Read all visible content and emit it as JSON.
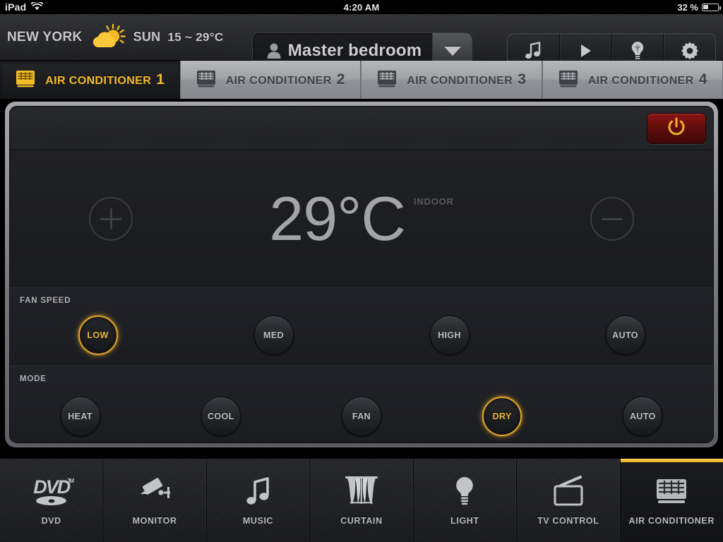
{
  "statusbar": {
    "device": "iPad",
    "wifi_icon": "wifi-icon",
    "time": "4:20 AM",
    "battery_percent": "32 %",
    "battery_icon": "battery-icon"
  },
  "header": {
    "city": "NEW YORK",
    "weather_icon": "sun-behind-cloud-icon",
    "day": "SUN",
    "temp_range": "15 ~ 29°C",
    "room": {
      "person_icon": "person-icon",
      "name": "Master bedroom",
      "caret_icon": "chevron-down-icon"
    },
    "icon_buttons": [
      {
        "name": "music-icon",
        "label": "Music"
      },
      {
        "name": "play-icon",
        "label": "Play"
      },
      {
        "name": "lightbulb-icon",
        "label": "Light"
      },
      {
        "name": "gear-icon",
        "label": "Settings"
      }
    ]
  },
  "tabs": [
    {
      "label": "AIR CONDITIONER",
      "number": "1",
      "icon": "air-conditioner-icon",
      "active": true
    },
    {
      "label": "AIR CONDITIONER",
      "number": "2",
      "icon": "air-conditioner-icon",
      "active": false
    },
    {
      "label": "AIR CONDITIONER",
      "number": "3",
      "icon": "air-conditioner-icon",
      "active": false
    },
    {
      "label": "AIR CONDITIONER",
      "number": "4",
      "icon": "air-conditioner-icon",
      "active": false
    }
  ],
  "panel": {
    "power_button": {
      "icon": "power-icon",
      "color": "#6b0f0d",
      "glyph_color": "#f0b429"
    },
    "temperature": {
      "value": "29°C",
      "label": "INDOOR",
      "increase_icon": "plus-circle-icon",
      "decrease_icon": "minus-circle-icon"
    },
    "fan_speed": {
      "title": "FAN SPEED",
      "options": [
        {
          "label": "LOW",
          "selected": true
        },
        {
          "label": "MED",
          "selected": false
        },
        {
          "label": "HIGH",
          "selected": false
        },
        {
          "label": "AUTO",
          "selected": false
        }
      ]
    },
    "mode": {
      "title": "MODE",
      "options": [
        {
          "label": "HEAT",
          "selected": false
        },
        {
          "label": "COOL",
          "selected": false
        },
        {
          "label": "FAN",
          "selected": false
        },
        {
          "label": "DRY",
          "selected": true
        },
        {
          "label": "AUTO",
          "selected": false
        }
      ]
    }
  },
  "bottom_nav": [
    {
      "label": "DVD",
      "icon": "dvd-icon",
      "active": false
    },
    {
      "label": "MONITOR",
      "icon": "security-camera-icon",
      "active": false
    },
    {
      "label": "MUSIC",
      "icon": "music-note-icon",
      "active": false
    },
    {
      "label": "CURTAIN",
      "icon": "curtain-icon",
      "active": false
    },
    {
      "label": "LIGHT",
      "icon": "lightbulb-icon",
      "active": false
    },
    {
      "label": "TV CONTROL",
      "icon": "tv-icon",
      "active": false
    },
    {
      "label": "AIR CONDITIONER",
      "icon": "air-conditioner-icon",
      "active": true
    }
  ],
  "colors": {
    "accent": "#e9b63b",
    "active_tab_text": "#f5bc2a",
    "power_red": "#6b0f0d",
    "panel_bg": "#1c1d20"
  }
}
